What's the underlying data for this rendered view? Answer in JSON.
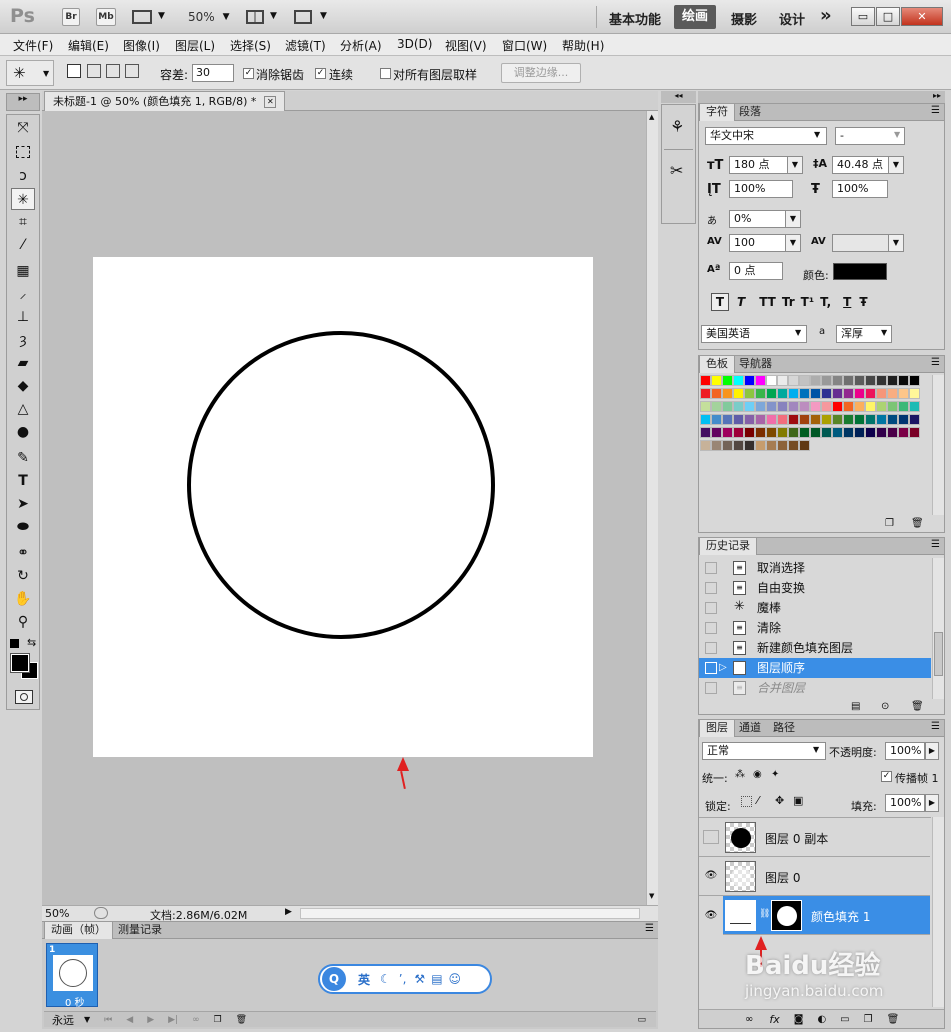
{
  "appbar": {
    "logo": "Ps",
    "bridge": "Br",
    "minibridge": "Mb",
    "zoom": "50%",
    "workspaces": [
      "基本功能",
      "绘画",
      "摄影",
      "设计"
    ],
    "active_workspace": "绘画",
    "more": "»",
    "win_min": "▭",
    "win_max": "□",
    "win_close": "✕"
  },
  "menu": [
    "文件(F)",
    "编辑(E)",
    "图像(I)",
    "图层(L)",
    "选择(S)",
    "滤镜(T)",
    "分析(A)",
    "3D(D)",
    "视图(V)",
    "窗口(W)",
    "帮助(H)"
  ],
  "options": {
    "tolerance_label": "容差:",
    "tolerance_value": "30",
    "antialias_label": "消除锯齿",
    "contiguous_label": "连续",
    "sample_all_label": "对所有图层取样",
    "refine_edge": "调整边缘..."
  },
  "document": {
    "tab_title": "未标题-1 @ 50% (颜色填充 1, RGB/8) *",
    "tab_close": "✕"
  },
  "statusbar": {
    "zoom": "50%",
    "doc_info": "文档:2.86M/6.02M"
  },
  "animation": {
    "tabs": [
      "动画（帧）",
      "测量记录"
    ],
    "frame_number": "1",
    "frame_delay": "0 秒",
    "loop": "永远"
  },
  "ime": {
    "logo": "Q",
    "lang": "英"
  },
  "character": {
    "tabs": [
      "字符",
      "段落"
    ],
    "font_family": "华文中宋",
    "font_style": "-",
    "size": "180 点",
    "leading": "40.48 点",
    "vscale": "100%",
    "hscale": "100%",
    "tsume": "0%",
    "tracking": "100",
    "kerning": "",
    "baseline": "0 点",
    "color_label": "颜色:",
    "color_value": "#000000",
    "styles": [
      "T",
      "T",
      "TT",
      "Tr",
      "T¹",
      "T,",
      "T",
      "Ŧ"
    ],
    "language": "美国英语",
    "aa_label": "a",
    "aa_value": "浑厚"
  },
  "swatches": {
    "tabs": [
      "色板",
      "导航器"
    ],
    "row1": [
      "#ff0000",
      "#ffff00",
      "#00ff00",
      "#00ffff",
      "#0000ff",
      "#ff00ff",
      "#ffffff",
      "#ebebeb",
      "#d6d6d6",
      "#c2c2c2",
      "#adadad",
      "#999999",
      "#858585",
      "#707070",
      "#5c5c5c",
      "#474747",
      "#333333",
      "#1f1f1f",
      "#0a0a0a",
      "#000000"
    ],
    "row2": [
      "#ee1d24",
      "#f26522",
      "#f7941d",
      "#fff200",
      "#8dc63f",
      "#39b54a",
      "#00a651",
      "#00a99d",
      "#00aeef",
      "#0072bc",
      "#0054a6",
      "#2e3192",
      "#662d91",
      "#92278f",
      "#ec008c",
      "#ed145b",
      "#f69679",
      "#f9ad81",
      "#fdc689",
      "#fff799"
    ],
    "row3": [
      "#c4df9b",
      "#a3d39c",
      "#82ca9c",
      "#7accc8",
      "#6dcff6",
      "#7da7d9",
      "#8393ca",
      "#8882be",
      "#a187be",
      "#bc8dbf",
      "#f49ac2",
      "#f6989d",
      "#ff0000",
      "#f26522",
      "#fbaf5d",
      "#fff568",
      "#acd373",
      "#7cc576",
      "#3cb878",
      "#1cbbb4"
    ],
    "row4": [
      "#00bff3",
      "#448ccb",
      "#5674b9",
      "#605ca8",
      "#8560a8",
      "#a864a8",
      "#f06eaa",
      "#f26d7d",
      "#9e0b0f",
      "#a0410d",
      "#a36209",
      "#aba000",
      "#598527",
      "#197b30",
      "#007236",
      "#00746b",
      "#0076a3",
      "#004a80",
      "#003471",
      "#1b1464"
    ],
    "row5": [
      "#440e62",
      "#630460",
      "#9e005d",
      "#9e0039",
      "#790000",
      "#7b2e00",
      "#7d4900",
      "#827b00",
      "#406618",
      "#005e20",
      "#005826",
      "#005952",
      "#005b7f",
      "#003663",
      "#002157",
      "#0d004c",
      "#32004b",
      "#4b0049",
      "#7b0046",
      "#7a0026"
    ],
    "row6": [
      "#c7b299",
      "#998675",
      "#736357",
      "#534741",
      "#362f2d",
      "#c69c6d",
      "#a67c52",
      "#8c6239",
      "#754c24",
      "#603913"
    ]
  },
  "history": {
    "tab": "历史记录",
    "items": [
      "取消选择",
      "自由变换",
      "魔棒",
      "清除",
      "新建颜色填充图层",
      "图层顺序",
      "合并图层"
    ],
    "selected_index": 5
  },
  "layers": {
    "tabs": [
      "图层",
      "通道",
      "路径"
    ],
    "blend_mode": "正常",
    "opacity_label": "不透明度:",
    "opacity": "100%",
    "unify_label": "统一:",
    "propagate_label": "传播帧 1",
    "lock_label": "锁定:",
    "fill_label": "填充:",
    "fill": "100%",
    "items": [
      {
        "name": "图层 0 副本",
        "visible": false
      },
      {
        "name": "图层 0",
        "visible": true
      },
      {
        "name": "颜色填充 1",
        "visible": true
      }
    ],
    "bottom_fx": "fx"
  },
  "watermark": {
    "brand": "Baidu经验",
    "url": "jingyan.baidu.com"
  }
}
